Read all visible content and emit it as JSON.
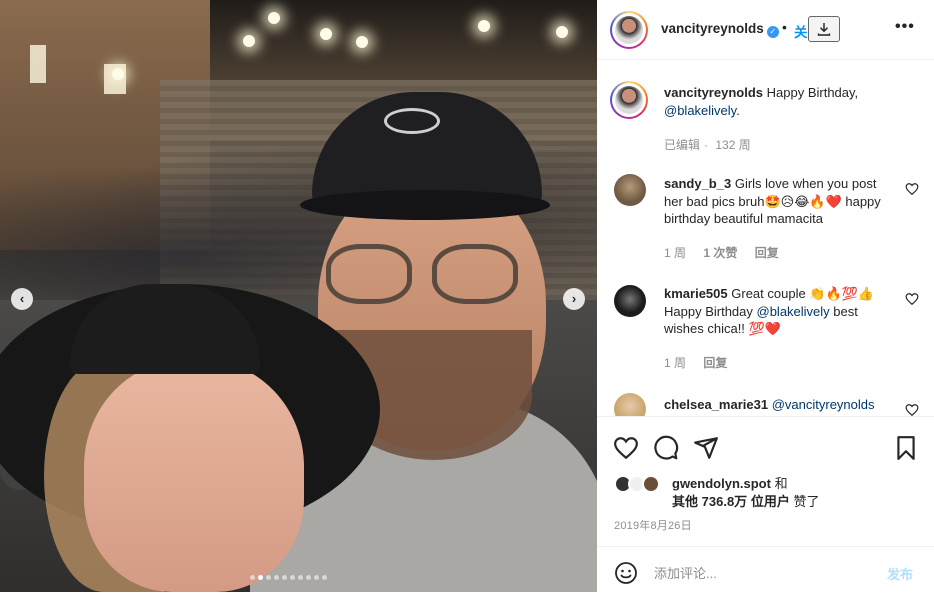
{
  "post": {
    "image_alt": "",
    "carousel": {
      "total": 10,
      "active_index": 1
    }
  },
  "header": {
    "username": "vancityreynolds",
    "verified_mark": "✓",
    "separator": "•",
    "follow_label": "关",
    "more_label": "•••"
  },
  "caption": {
    "username": "vancityreynolds",
    "text": "Happy Birthday,",
    "mention": "@blakelively",
    "trailing": ".",
    "edited_label": "已编辑",
    "time": "132 周"
  },
  "comments": [
    {
      "username": "sandy_b_3",
      "text_line": "Girls love when you post her bad pics bruh🤩😥😂🔥❤️ happy birthday beautiful mamacita",
      "time": "1 周",
      "likes": "1 次赞",
      "reply": "回复"
    },
    {
      "username": "kmarie505",
      "text_before": "Great couple 👏🔥💯👍 Happy Birthday ",
      "mention": "@blakelively",
      "text_after": " best wishes chica!! 💯❤️",
      "time": "1 周",
      "reply": "回复"
    },
    {
      "username": "chelsea_marie31",
      "mention": "@vancityreynolds"
    }
  ],
  "likes": {
    "liker": "gwendolyn.spot",
    "and": "和",
    "others_prefix": "其他",
    "count": "736.8万",
    "others_suffix": "位用户",
    "liked": "赞了"
  },
  "date": "2019年8月26日",
  "composer": {
    "placeholder": "添加评论...",
    "post_label": "发布"
  },
  "nav": {
    "prev": "‹",
    "next": "›"
  },
  "icons": [
    "heart-icon",
    "comment-icon",
    "share-icon",
    "bookmark-icon",
    "emoji-icon",
    "download-icon",
    "verified-icon"
  ],
  "colors": {
    "accent": "#0095f6",
    "mention": "#00376b",
    "muted": "#8e8e8e",
    "post_disabled": "#b2dffc"
  }
}
